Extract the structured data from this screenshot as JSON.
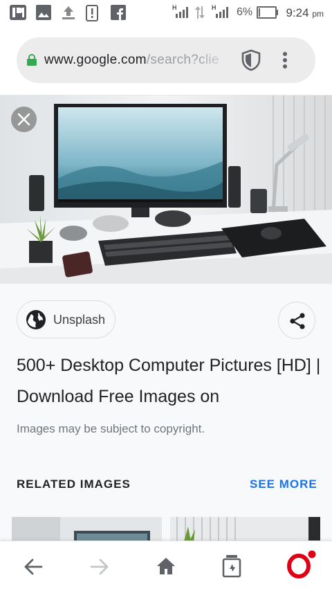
{
  "status_bar": {
    "battery_percent": "6%",
    "time": "9:24",
    "time_suffix": "pm",
    "notification_icons": [
      "pushbullet-icon",
      "image-icon",
      "upload-icon",
      "alert-icon",
      "facebook-icon"
    ],
    "network_badges": [
      "H",
      "H"
    ]
  },
  "browser": {
    "url_domain": "www.google.com",
    "url_path": "/search?clie",
    "lock_color": "#34a853"
  },
  "image_viewer": {
    "source_label": "Unsplash",
    "title": "500+ Desktop Computer Pictures [HD] | Download Free Images on",
    "copyright_note": "Images may be subject to copyright.",
    "related_label": "RELATED IMAGES",
    "see_more_label": "SEE MORE",
    "accent_color": "#1a73e8"
  },
  "bottom_nav": {
    "items": [
      "back-icon",
      "forward-icon",
      "home-icon",
      "tabs-icon",
      "opera-icon"
    ],
    "brand_color": "#e00016"
  }
}
